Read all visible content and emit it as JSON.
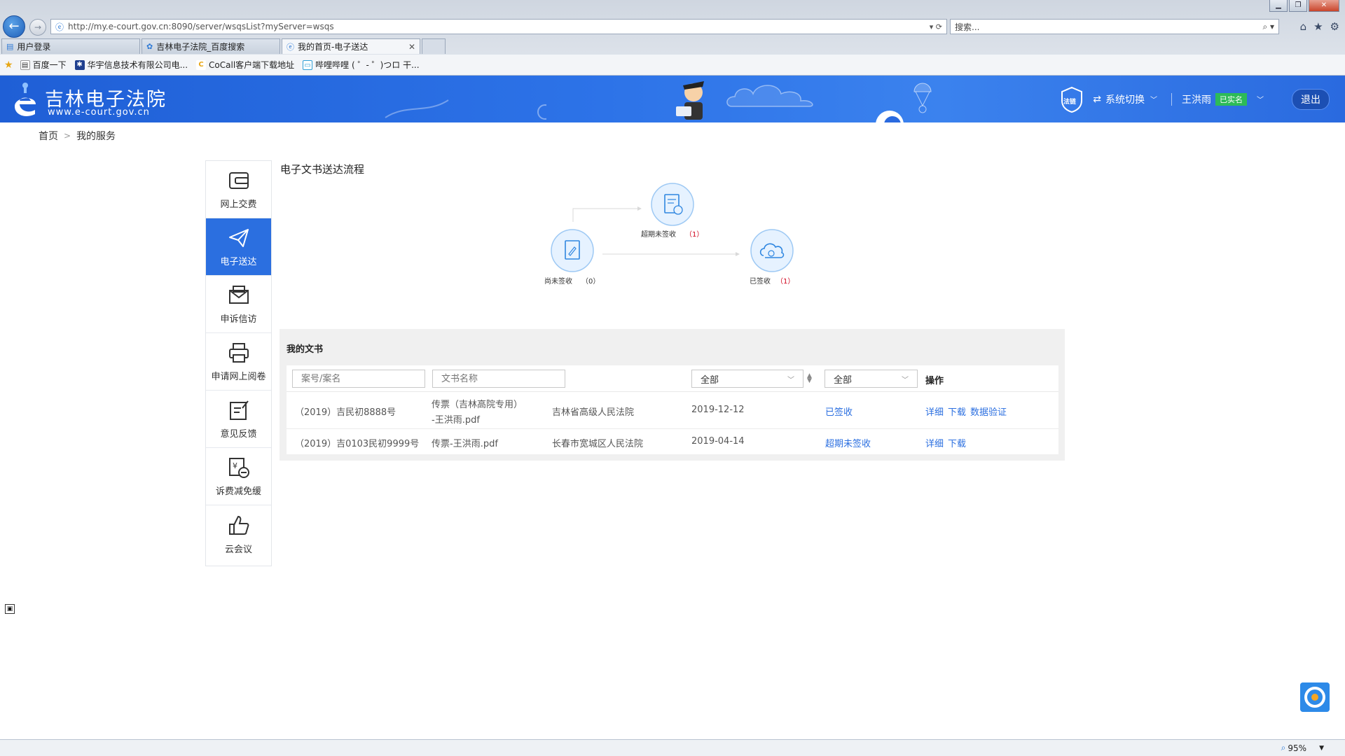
{
  "browser": {
    "url": "http://my.e-court.gov.cn:8090/server/wsqsList?myServer=wsqs",
    "search_placeholder": "搜索...",
    "tabs": [
      {
        "label": "用户登录",
        "active": false
      },
      {
        "label": "吉林电子法院_百度搜索",
        "active": false
      },
      {
        "label": "我的首页-电子送达",
        "active": true
      }
    ],
    "favorites": [
      {
        "label": "百度一下"
      },
      {
        "label": "华宇信息技术有限公司电..."
      },
      {
        "label": "CoCall客户端下载地址"
      },
      {
        "label": "哔哩哔哩 ( ゜- ゜)つロ 干..."
      }
    ],
    "zoom": "95%"
  },
  "header": {
    "title": "吉林电子法院",
    "subtitle": "www.e-court.gov.cn",
    "badge_text": "法链",
    "system_switch": "系统切换",
    "user_name": "王洪雨",
    "verified": "已实名",
    "logout": "退出"
  },
  "breadcrumb": {
    "home": "首页",
    "current": "我的服务"
  },
  "sidebar": {
    "items": [
      {
        "label": "网上交费",
        "icon": "wallet-icon",
        "active": false
      },
      {
        "label": "电子送达",
        "icon": "paper-plane-icon",
        "active": true
      },
      {
        "label": "申诉信访",
        "icon": "envelope-icon",
        "active": false
      },
      {
        "label": "申请网上阅卷",
        "icon": "printer-icon",
        "active": false
      },
      {
        "label": "意见反馈",
        "icon": "edit-note-icon",
        "active": false
      },
      {
        "label": "诉费减免缓",
        "icon": "fee-reduce-icon",
        "active": false
      },
      {
        "label": "云会议",
        "icon": "thumbs-up-icon",
        "active": false
      }
    ]
  },
  "process": {
    "title": "电子文书送达流程",
    "nodes": [
      {
        "label": "尚未签收",
        "count": "（0）"
      },
      {
        "label": "超期未签收",
        "count": "（1）"
      },
      {
        "label": "已签收",
        "count": "（1）"
      }
    ]
  },
  "documents": {
    "title": "我的文书",
    "filters": {
      "case_placeholder": "案号/案名",
      "doc_placeholder": "文书名称",
      "date_select": "全部",
      "status_select": "全部",
      "ops_header": "操作"
    },
    "rows": [
      {
        "case_no": "（2019）吉民初8888号",
        "doc_line1": "传票（吉林高院专用）",
        "doc_line2": "-王洪雨.pdf",
        "court": "吉林省高级人民法院",
        "date": "2019-12-12",
        "status": "已签收",
        "ops": [
          "详细",
          "下载",
          "数据验证"
        ]
      },
      {
        "case_no": "（2019）吉0103民初9999号",
        "doc_line1": "传票-王洪雨.pdf",
        "doc_line2": "",
        "court": "长春市宽城区人民法院",
        "date": "2019-04-14",
        "status": "超期未签收",
        "ops": [
          "详细",
          "下载"
        ]
      }
    ]
  }
}
